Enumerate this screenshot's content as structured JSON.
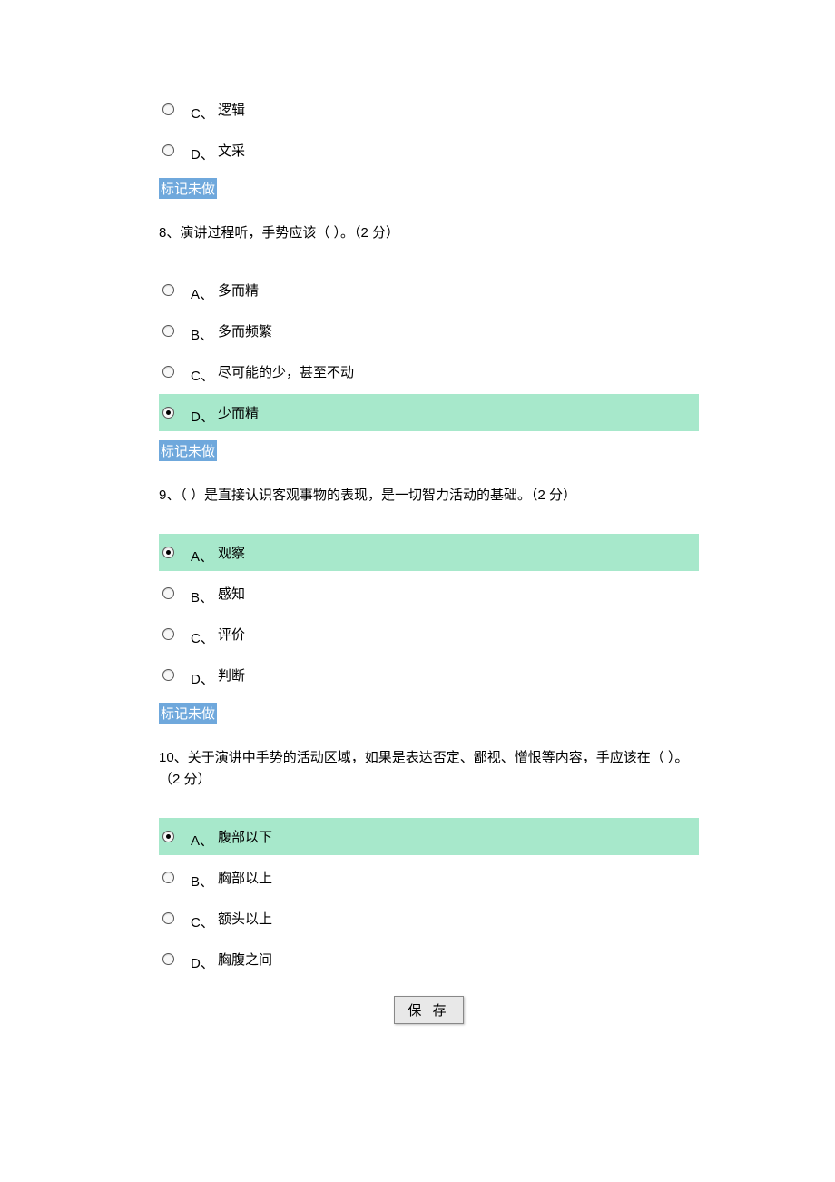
{
  "partial_question": {
    "options": [
      {
        "letter": "C、",
        "text": "逻辑",
        "selected": false
      },
      {
        "letter": "D、",
        "text": "文采",
        "selected": false
      }
    ],
    "mark": "标记未做"
  },
  "questions": [
    {
      "number": "8、",
      "text": "演讲过程听，手势应该（ ）。（2 分）",
      "options": [
        {
          "letter": "A、",
          "text": "多而精",
          "selected": false
        },
        {
          "letter": "B、",
          "text": "多而频繁",
          "selected": false
        },
        {
          "letter": "C、",
          "text": "尽可能的少，甚至不动",
          "selected": false
        },
        {
          "letter": "D、",
          "text": "少而精",
          "selected": true
        }
      ],
      "mark": "标记未做"
    },
    {
      "number": "9、",
      "text": "（ ）是直接认识客观事物的表现，是一切智力活动的基础。（2 分）",
      "options": [
        {
          "letter": "A、",
          "text": "观察",
          "selected": true
        },
        {
          "letter": "B、",
          "text": "感知",
          "selected": false
        },
        {
          "letter": "C、",
          "text": "评价",
          "selected": false
        },
        {
          "letter": "D、",
          "text": "判断",
          "selected": false
        }
      ],
      "mark": "标记未做"
    },
    {
      "number": "10、",
      "text": "关于演讲中手势的活动区域，如果是表达否定、鄙视、憎恨等内容，手应该在（ ）。（2 分）",
      "options": [
        {
          "letter": "A、",
          "text": "腹部以下",
          "selected": true
        },
        {
          "letter": "B、",
          "text": "胸部以上",
          "selected": false
        },
        {
          "letter": "C、",
          "text": "额头以上",
          "selected": false
        },
        {
          "letter": "D、",
          "text": "胸腹之间",
          "selected": false
        }
      ],
      "mark": ""
    }
  ],
  "save_button": "保 存"
}
